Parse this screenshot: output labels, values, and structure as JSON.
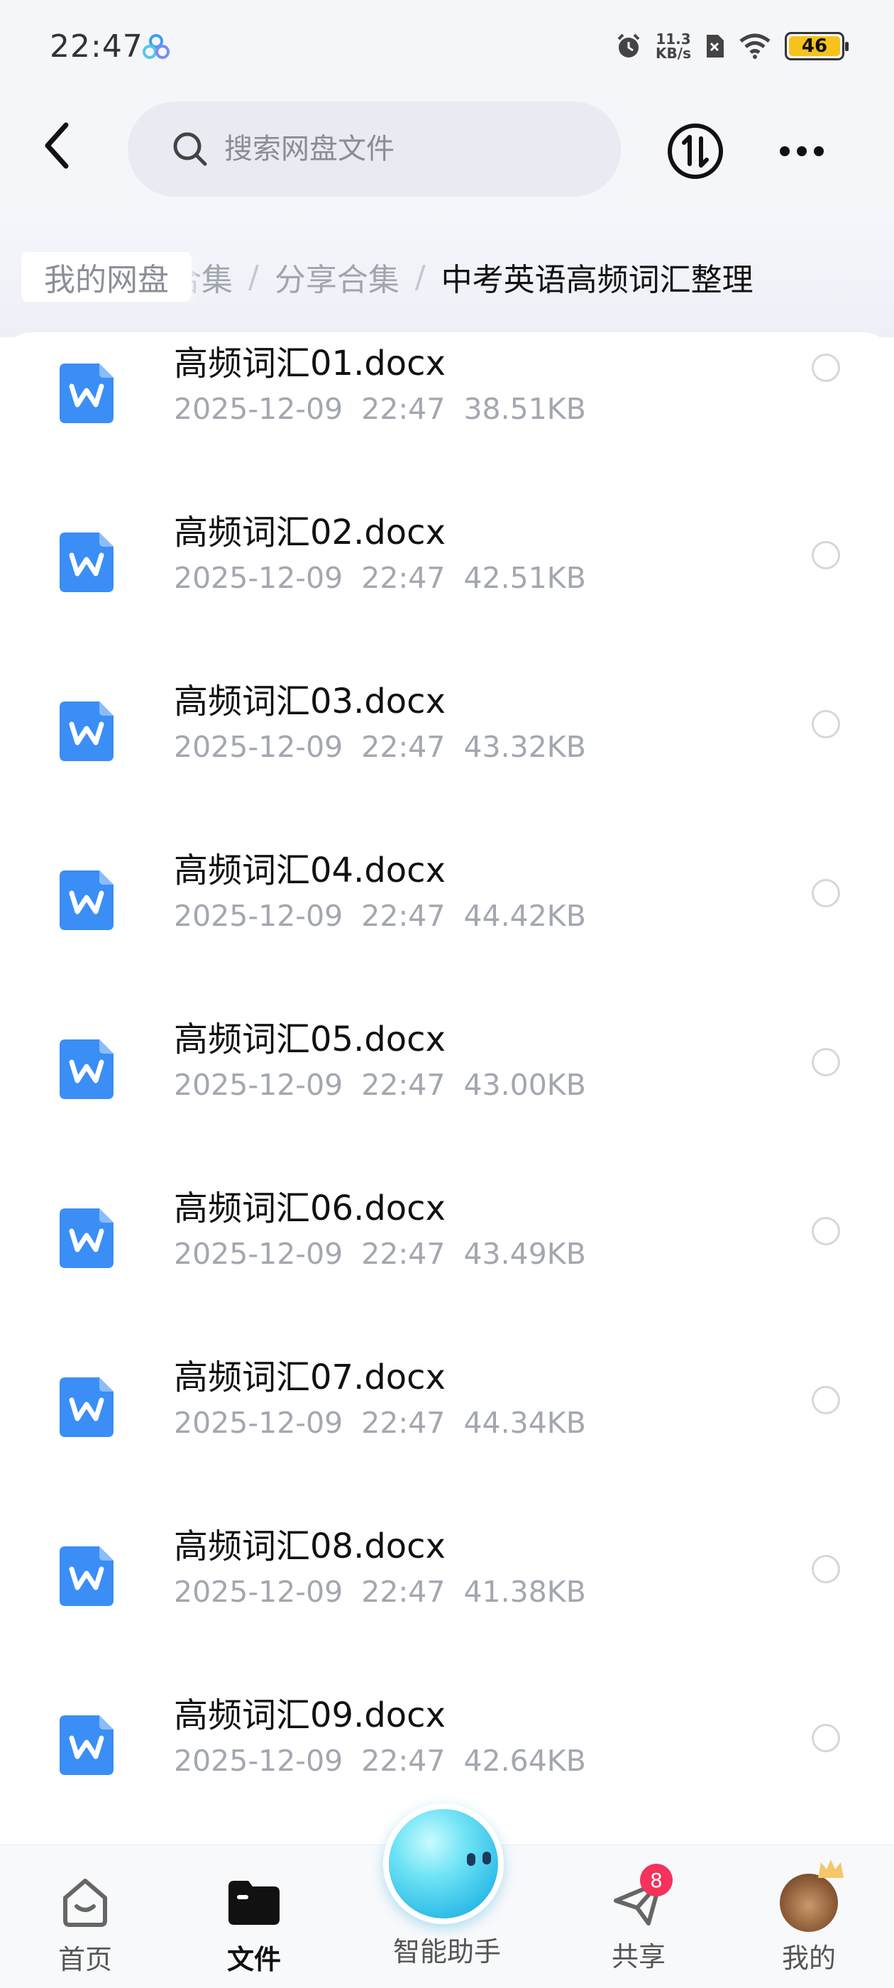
{
  "status_bar": {
    "time": "22:47",
    "net_speed_value": "11.3",
    "net_speed_unit": "KB/s",
    "battery": "46"
  },
  "header": {
    "search_placeholder": "搜索网盘文件"
  },
  "breadcrumb": {
    "home": "我的网盘",
    "items": [
      "料合集",
      "分享合集"
    ],
    "current": "中考英语高频词汇整理"
  },
  "files": [
    {
      "name": "高频词汇01.docx",
      "date": "2025-12-09",
      "time": "22:47",
      "size": "38.51KB"
    },
    {
      "name": "高频词汇02.docx",
      "date": "2025-12-09",
      "time": "22:47",
      "size": "42.51KB"
    },
    {
      "name": "高频词汇03.docx",
      "date": "2025-12-09",
      "time": "22:47",
      "size": "43.32KB"
    },
    {
      "name": "高频词汇04.docx",
      "date": "2025-12-09",
      "time": "22:47",
      "size": "44.42KB"
    },
    {
      "name": "高频词汇05.docx",
      "date": "2025-12-09",
      "time": "22:47",
      "size": "43.00KB"
    },
    {
      "name": "高频词汇06.docx",
      "date": "2025-12-09",
      "time": "22:47",
      "size": "43.49KB"
    },
    {
      "name": "高频词汇07.docx",
      "date": "2025-12-09",
      "time": "22:47",
      "size": "44.34KB"
    },
    {
      "name": "高频词汇08.docx",
      "date": "2025-12-09",
      "time": "22:47",
      "size": "41.38KB"
    },
    {
      "name": "高频词汇09.docx",
      "date": "2025-12-09",
      "time": "22:47",
      "size": "42.64KB"
    }
  ],
  "bottom_nav": {
    "home": "首页",
    "files": "文件",
    "assistant": "智能助手",
    "share": "共享",
    "share_badge": "8",
    "mine": "我的"
  },
  "colors": {
    "accent": "#3a8ef6",
    "badge": "#f5325c",
    "page_bg": "#f5f6fa"
  }
}
